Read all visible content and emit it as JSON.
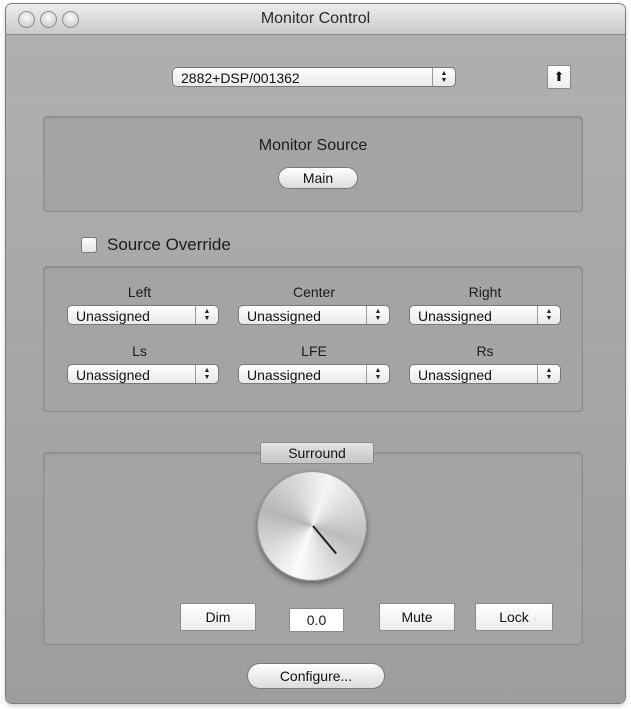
{
  "window": {
    "title": "Monitor Control"
  },
  "device": {
    "selected": "2882+DSP/001362",
    "up_arrow": "⬆"
  },
  "monitor_source": {
    "title": "Monitor Source",
    "button_label": "Main"
  },
  "override": {
    "label": "Source Override",
    "checked": false
  },
  "channels": [
    {
      "name": "Left",
      "value": "Unassigned"
    },
    {
      "name": "Center",
      "value": "Unassigned"
    },
    {
      "name": "Right",
      "value": "Unassigned"
    },
    {
      "name": "Ls",
      "value": "Unassigned"
    },
    {
      "name": "LFE",
      "value": "Unassigned"
    },
    {
      "name": "Rs",
      "value": "Unassigned"
    }
  ],
  "surround": {
    "label": "Surround",
    "level": "0.0",
    "dim_label": "Dim",
    "mute_label": "Mute",
    "lock_label": "Lock"
  },
  "configure_label": "Configure..."
}
